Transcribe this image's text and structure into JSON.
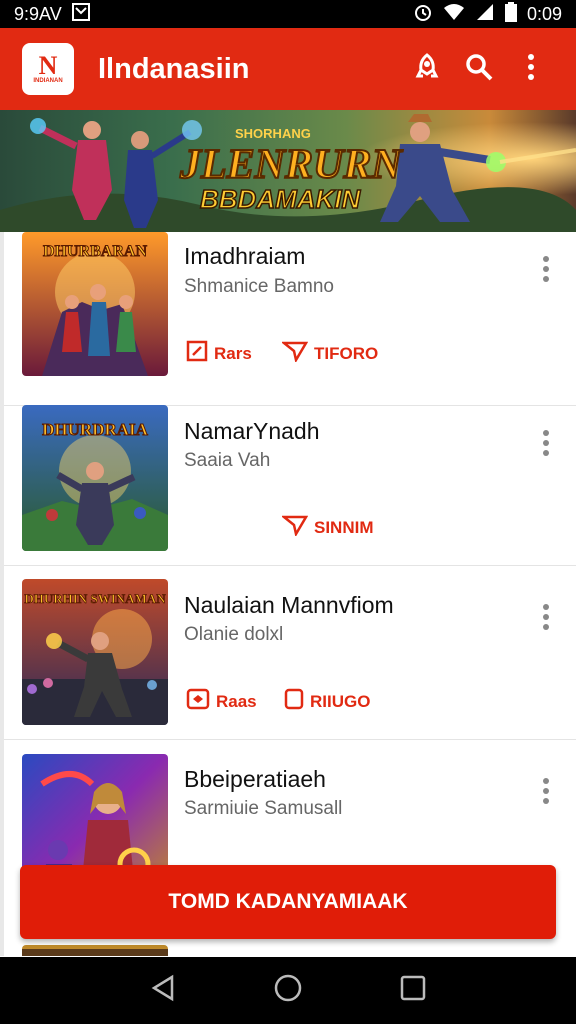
{
  "status": {
    "time_left": "9:9AV",
    "time_right": "0:09"
  },
  "app": {
    "title": "Ilndanasiin",
    "logo_letter": "N",
    "logo_text": "INDIANAN"
  },
  "banner": {
    "line1": "SHORHANG",
    "line2": "JLENRURN",
    "line3": "BBDAMAKIN"
  },
  "items": [
    {
      "title": "Imadhraiam",
      "subtitle": "Shmanice Bamno",
      "thumb_text": "DHURBARAN",
      "action1": "Rars",
      "action2": "TIFORO"
    },
    {
      "title": "NamarYnadh",
      "subtitle": "Saaia Vah",
      "thumb_text": "DHURDRAIA",
      "action2": "SINNIM"
    },
    {
      "title": "Naulaian Mannvfiom",
      "subtitle": "Olanie dolxl",
      "thumb_text": "DHURHIN SWINAMAN",
      "action1": "Raas",
      "action2": "RIIUGO"
    },
    {
      "title": "Bbeiperatiaeh",
      "subtitle": "Sarmiuie Samusall",
      "thumb_text": ""
    }
  ],
  "cta": {
    "label": "TOMD KADANYAMIAAK"
  },
  "colors": {
    "brand": "#e12a12"
  },
  "icons": [
    "rocket-icon",
    "search-icon",
    "more-vert-icon",
    "back-icon",
    "home-icon",
    "recents-icon"
  ]
}
